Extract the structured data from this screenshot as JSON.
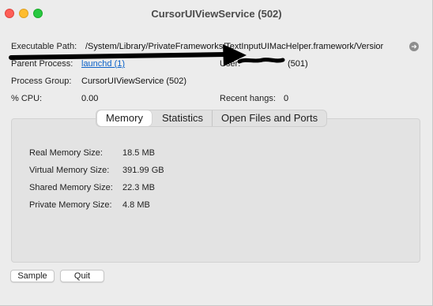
{
  "window": {
    "title": "CursorUIViewService (502)"
  },
  "info": {
    "executable_path_label": "Executable Path:",
    "executable_path_value": "/System/Library/PrivateFrameworks/TextInputUIMacHelper.framework/Versior",
    "parent_process_label": "Parent Process:",
    "parent_process_value": "launchd (1)",
    "user_label": "User:",
    "user_value": "(501)",
    "process_group_label": "Process Group:",
    "process_group_value": "CursorUIViewService (502)",
    "cpu_label": "% CPU:",
    "cpu_value": "0.00",
    "recent_hangs_label": "Recent hangs:",
    "recent_hangs_value": "0"
  },
  "tabs": {
    "memory": "Memory",
    "statistics": "Statistics",
    "open_files": "Open Files and Ports"
  },
  "memory": {
    "real_label": "Real Memory Size:",
    "real_value": "18.5 MB",
    "virtual_label": "Virtual Memory Size:",
    "virtual_value": "391.99 GB",
    "shared_label": "Shared Memory Size:",
    "shared_value": "22.3 MB",
    "private_label": "Private Memory Size:",
    "private_value": "4.8 MB"
  },
  "buttons": {
    "sample": "Sample",
    "quit": "Quit"
  },
  "icons": {
    "reveal": "arrow-right-circle-icon"
  },
  "colors": {
    "link": "#0b62c9",
    "close": "#fe5f57",
    "minimize": "#febc2e",
    "zoom": "#28c840"
  }
}
